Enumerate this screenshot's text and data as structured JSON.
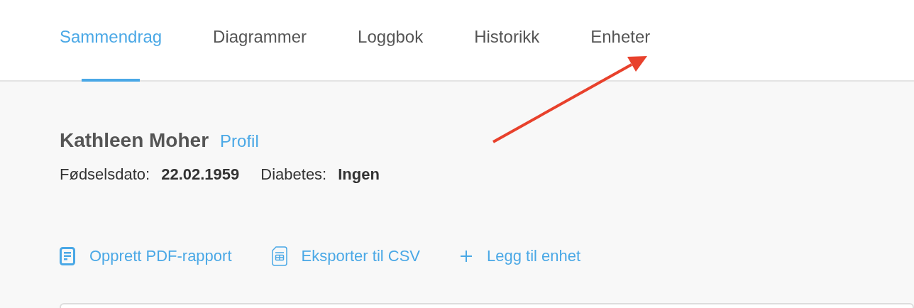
{
  "tabs": [
    {
      "label": "Sammendrag",
      "selected": true
    },
    {
      "label": "Diagrammer",
      "selected": false
    },
    {
      "label": "Loggbok",
      "selected": false
    },
    {
      "label": "Historikk",
      "selected": false
    },
    {
      "label": "Enheter",
      "selected": false
    }
  ],
  "patient": {
    "name": "Kathleen Moher",
    "profile_link": "Profil",
    "fields": [
      {
        "label": "Fødselsdato:",
        "value": "22.02.1959"
      },
      {
        "label": "Diabetes:",
        "value": "Ingen"
      }
    ]
  },
  "actions": [
    {
      "kind": "pdf",
      "label": "Opprett PDF-rapport"
    },
    {
      "kind": "csv",
      "label": "Eksporter til CSV"
    },
    {
      "kind": "add",
      "label": "Legg til enhet"
    }
  ]
}
